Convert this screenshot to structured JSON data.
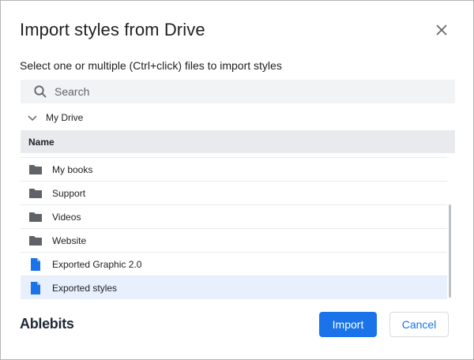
{
  "dialog": {
    "title": "Import styles from Drive",
    "subtitle": "Select one or multiple (Ctrl+click) files to import styles",
    "close_icon": "close-icon"
  },
  "search": {
    "placeholder": "Search",
    "icon": "search-icon"
  },
  "breadcrumb": {
    "label": "My Drive",
    "icon": "chevron-down-icon"
  },
  "table": {
    "header": "Name",
    "rows": [
      {
        "label": "My books",
        "icon": "folder-icon",
        "selected": false
      },
      {
        "label": "Support",
        "icon": "folder-icon",
        "selected": false
      },
      {
        "label": "Videos",
        "icon": "folder-icon",
        "selected": false
      },
      {
        "label": "Website",
        "icon": "folder-icon",
        "selected": false
      },
      {
        "label": "Exported Graphic 2.0",
        "icon": "document-icon",
        "selected": false
      },
      {
        "label": "Exported styles",
        "icon": "document-icon",
        "selected": true
      }
    ]
  },
  "footer": {
    "brand": "Ablebits",
    "import_label": "Import",
    "cancel_label": "Cancel"
  },
  "colors": {
    "accent": "#1a73e8",
    "selected_row": "#e8f0fe",
    "header_bg": "#e8eaed",
    "search_bg": "#f1f3f4",
    "folder": "#5f6368",
    "document": "#1a73e8"
  }
}
